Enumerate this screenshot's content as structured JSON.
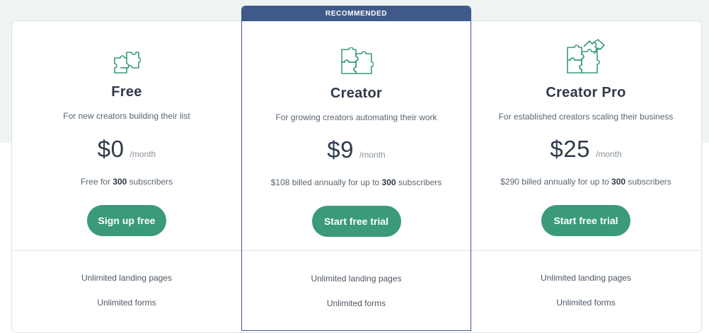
{
  "plans": [
    {
      "name": "Free",
      "description": "For new creators building their list",
      "price": "$0",
      "period": "/month",
      "billing_prefix": "Free for ",
      "billing_count": "300",
      "billing_suffix": " subscribers",
      "cta": "Sign up free",
      "icon": "puzzle-icon",
      "features": [
        "Unlimited landing pages",
        "Unlimited forms"
      ]
    },
    {
      "name": "Creator",
      "badge": "RECOMMENDED",
      "description": "For growing creators automating their work",
      "price": "$9",
      "period": "/month",
      "billing_prefix": "$108 billed annually for up to ",
      "billing_count": "300",
      "billing_suffix": " subscribers",
      "cta": "Start free trial",
      "icon": "puzzle-icon",
      "features": [
        "Unlimited landing pages",
        "Unlimited forms"
      ]
    },
    {
      "name": "Creator Pro",
      "description": "For established creators scaling their business",
      "price": "$25",
      "period": "/month",
      "billing_prefix": "$290 billed annually for up to ",
      "billing_count": "300",
      "billing_suffix": " subscribers",
      "cta": "Start free trial",
      "icon": "puzzle-icon",
      "features": [
        "Unlimited landing pages",
        "Unlimited forms"
      ]
    }
  ],
  "colors": {
    "accent": "#3a9a7a",
    "badge": "#3f5a8a",
    "heading": "#2f3a4a",
    "muted": "#5a6570"
  }
}
